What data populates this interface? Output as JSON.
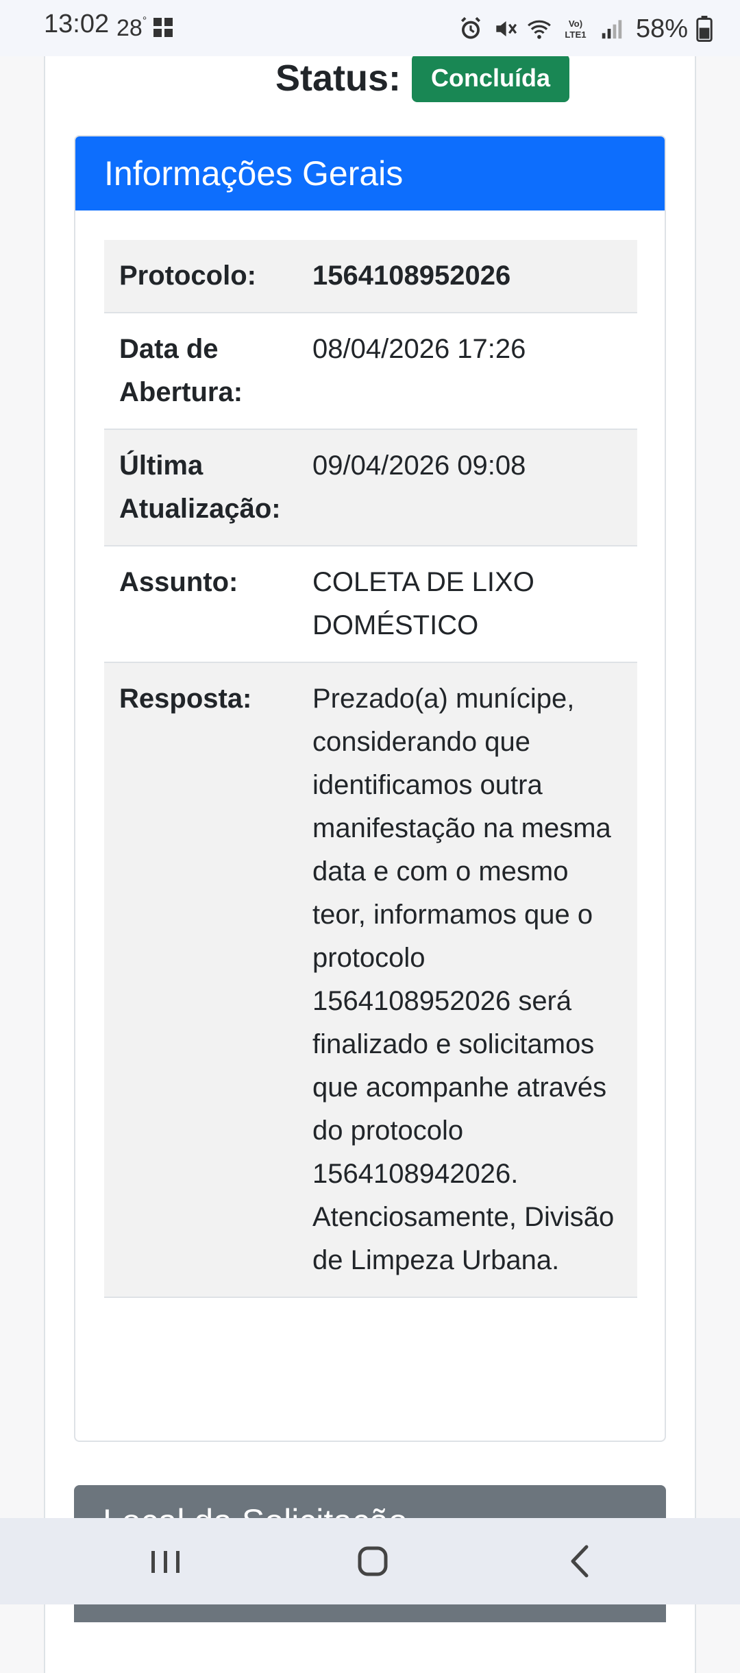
{
  "status_bar": {
    "time": "13:02",
    "temperature": "28",
    "temperature_unit": "°",
    "battery_percent": "58%",
    "icons": [
      "widget-icon",
      "alarm-icon",
      "mute-icon",
      "wifi-icon",
      "volte-icon",
      "signal-icon",
      "battery-icon"
    ],
    "volte_label": "Vo) LTE1"
  },
  "status": {
    "label": "Status:",
    "badge": "Concluída",
    "badge_color": "#198754"
  },
  "info_card": {
    "title": "Informações Gerais",
    "header_color": "#0d6efd",
    "rows": [
      {
        "label": "Protocolo:",
        "value": "1564108952026"
      },
      {
        "label": "Data de Abertura:",
        "value": "08/04/2026 17:26"
      },
      {
        "label": "Última Atualização:",
        "value": "09/04/2026 09:08"
      },
      {
        "label": "Assunto:",
        "value": "COLETA DE LIXO DOMÉSTICO"
      },
      {
        "label": "Resposta:",
        "value": "Prezado(a) munícipe, considerando que identificamos outra manifestação na mesma data e com o mesmo teor, informamos que o protocolo 1564108952026 será finalizado e solicitamos que acompanhe através do protocolo 1564108942026. Atenciosamente, Divisão de Limpeza Urbana."
      }
    ]
  },
  "local_card": {
    "title": "Local da Solicitação",
    "header_color": "#6c757d"
  },
  "nav_bar": {
    "buttons": [
      "recent-apps-icon",
      "home-icon",
      "back-icon"
    ]
  }
}
